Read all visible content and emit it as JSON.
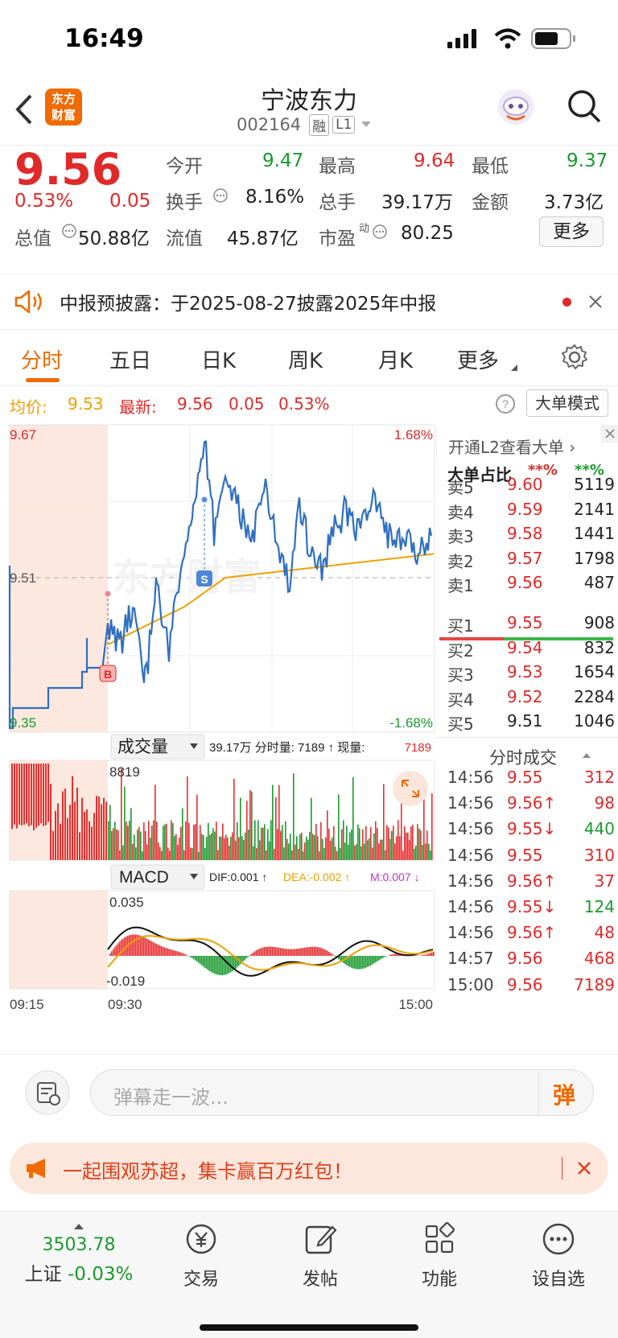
{
  "status": {
    "time": "16:49"
  },
  "header": {
    "logo_line1": "东方",
    "logo_line2": "财富",
    "title": "宁波东力",
    "code": "002164",
    "tag1": "融",
    "tag2": "L1"
  },
  "quote": {
    "price": "9.56",
    "pct": "0.53%",
    "chg": "0.05",
    "open_label": "今开",
    "open": "9.47",
    "high_label": "最高",
    "high": "9.64",
    "low_label": "最低",
    "low": "9.37",
    "turnover_label": "换手",
    "turnover": "8.16%",
    "vol_label": "总手",
    "vol": "39.17万",
    "amount_label": "金额",
    "amount": "3.73亿",
    "mcap_label": "总值",
    "mcap": "50.88亿",
    "float_label": "流值",
    "float": "45.87亿",
    "pe_label": "市盈",
    "pe_sup": "动",
    "pe": "80.25",
    "more": "更多"
  },
  "notice": {
    "text": "中报预披露：于2025-08-27披露2025年中报"
  },
  "tabs": [
    "分时",
    "五日",
    "日K",
    "周K",
    "月K",
    "更多"
  ],
  "info": {
    "avg_label": "均价:",
    "avg": "9.53",
    "latest_label": "最新:",
    "latest": "9.56",
    "chg": "0.05",
    "pct": "0.53%",
    "mode_btn": "大单模式"
  },
  "chart": {
    "ymax": "9.67",
    "ymid": "9.51",
    "ymin": "9.35",
    "pct_max": "1.68%",
    "pct_min": "-1.68%",
    "vol_selector": "成交量",
    "vol_info": "39.17万 分时量: 7189 ↑ 现量: ",
    "vol_now": "7189",
    "vol_max": "8819",
    "macd_selector": "MACD",
    "dif": "DIF:0.001 ↑",
    "dea": "DEA:-0.002 ↑",
    "m": "M:0.007 ↓",
    "macd_max": "0.035",
    "macd_min": "-0.019",
    "t_start": "09:15",
    "t_open": "09:30",
    "t_end": "15:00",
    "marker_b": "B",
    "marker_s": "S",
    "watermark": "东方财富"
  },
  "side": {
    "l2_title": "开通L2查看大单 ›",
    "big_label": "大单占比",
    "big_sell": "**%",
    "big_buy": "**%",
    "asks": [
      {
        "label": "卖5",
        "price": "9.60",
        "vol": "5119"
      },
      {
        "label": "卖4",
        "price": "9.59",
        "vol": "2141"
      },
      {
        "label": "卖3",
        "price": "9.58",
        "vol": "1441"
      },
      {
        "label": "卖2",
        "price": "9.57",
        "vol": "1798"
      },
      {
        "label": "卖1",
        "price": "9.56",
        "vol": "487"
      }
    ],
    "bids": [
      {
        "label": "买1",
        "price": "9.55",
        "vol": "908"
      },
      {
        "label": "买2",
        "price": "9.54",
        "vol": "832"
      },
      {
        "label": "买3",
        "price": "9.53",
        "vol": "1654"
      },
      {
        "label": "买4",
        "price": "9.52",
        "vol": "2284"
      },
      {
        "label": "买5",
        "price": "9.51",
        "vol": "1046"
      }
    ],
    "ticks_title": "分时成交",
    "ticks": [
      {
        "time": "14:56",
        "price": "9.55",
        "vol": "312"
      },
      {
        "time": "14:56",
        "price": "9.56↑",
        "vol": "98"
      },
      {
        "time": "14:56",
        "price": "9.55↓",
        "vol": "440"
      },
      {
        "time": "14:56",
        "price": "9.55",
        "vol": "310"
      },
      {
        "time": "14:56",
        "price": "9.56↑",
        "vol": "37"
      },
      {
        "time": "14:56",
        "price": "9.55↓",
        "vol": "124"
      },
      {
        "time": "14:56",
        "price": "9.56↑",
        "vol": "48"
      },
      {
        "time": "14:57",
        "price": "9.56",
        "vol": "468"
      },
      {
        "time": "15:00",
        "price": "9.56",
        "vol": "7189"
      }
    ]
  },
  "danmu": {
    "placeholder": "弹幕走一波...",
    "btn": "弹"
  },
  "promo": {
    "text": "一起围观苏超，集卡赢百万红包！"
  },
  "tabbar": {
    "index_value": "3503.78",
    "index_name": "上证",
    "index_pct": "-0.03%",
    "items": [
      "交易",
      "发帖",
      "功能",
      "设自选"
    ]
  },
  "colors": {
    "up": "#e02a2a",
    "down": "#1a9a2e",
    "accent": "#f06a00",
    "avg_line": "#f0a000",
    "price_line": "#2f6fc0"
  }
}
